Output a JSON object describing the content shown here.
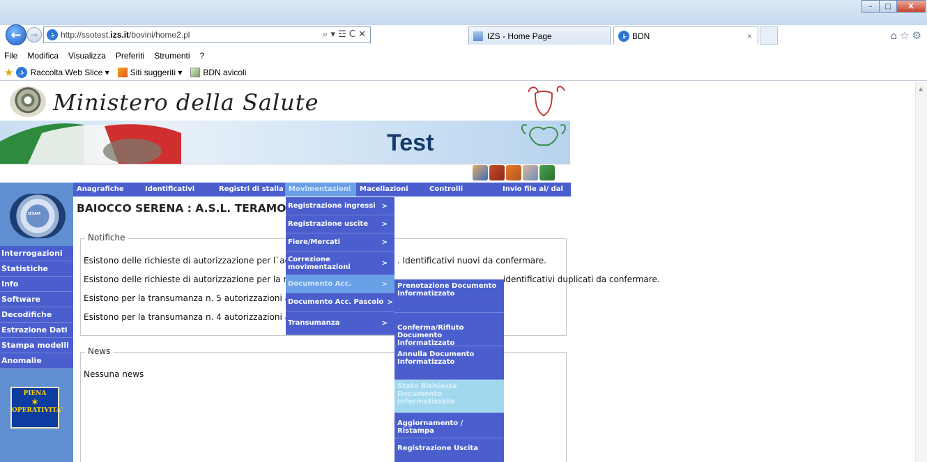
{
  "browser": {
    "url_prefix": "http://ssotest.",
    "url_domain": "izs.it",
    "url_suffix": "/bovini/home2.pl",
    "addr_tools": "⌕ ▾ ☲ C ✕",
    "tabs": [
      {
        "title": "IZS - Home Page"
      },
      {
        "title": "BDN",
        "close": "×"
      }
    ],
    "menu": [
      "File",
      "Modifica",
      "Visualizza",
      "Preferiti",
      "Strumenti",
      "?"
    ],
    "favorites": [
      {
        "label": "Raccolta Web Slice ▾"
      },
      {
        "label": "Siti suggeriti ▾"
      },
      {
        "label": "BDN avicoli"
      }
    ],
    "window_buttons": {
      "min": "–",
      "max": "□",
      "close": "X"
    },
    "right_icons": "⌂☆⚙",
    "back_glyph": "←",
    "fwd_glyph": "→"
  },
  "header": {
    "ministry": "Ministero della Salute",
    "test_label": "Test"
  },
  "nav": {
    "top": [
      "Anagrafiche",
      "Identificativi",
      "Registri di stalla",
      "Movimentazioni",
      "Macellazioni",
      "Controlli",
      "Invio file al/ dal"
    ],
    "active_index": 3,
    "left": [
      "Interrogazioni",
      "Statistiche",
      "Info",
      "Software",
      "Decodifiche",
      "Estrazione Dati",
      "Stampa modelli",
      "Anomalie"
    ]
  },
  "izsam_text": "IZSAM",
  "piena": {
    "line1": "PIENA",
    "stars": "✶",
    "line2": "OPERATIVITA'"
  },
  "user_title": "BAIOCCO SERENA : A.S.L. TERAMO",
  "notifiche": {
    "legend": "Notifiche",
    "rows": [
      {
        "left": "Esistono delle richieste di autorizzazione per l`ac",
        "right": ". Identificativi nuovi da confermare."
      },
      {
        "left": "Esistono delle richieste di autorizzazione per la ri",
        "right": "identificativi duplicati da confermare."
      },
      {
        "left": "Esistono per la transumanza n. 5 autorizzazioni a",
        "right": ""
      },
      {
        "left": "Esistono per la transumanza n. 4 autorizzazioni a",
        "right": ""
      }
    ]
  },
  "news": {
    "legend": "News",
    "text": "Nessuna news"
  },
  "dropdown_movimentazioni": [
    {
      "label": "Registrazione ingressi",
      "arrow": ">"
    },
    {
      "label": "Registrazione uscite",
      "arrow": ">"
    },
    {
      "label": "Fiere/Mercati",
      "arrow": ">"
    },
    {
      "label": "Correzione movimentazioni",
      "arrow": ">"
    },
    {
      "label": "Documento Acc.",
      "arrow": ">"
    },
    {
      "label": "Documento Acc. Pascolo",
      "arrow": ">"
    },
    {
      "label": "Transumanza",
      "arrow": ">"
    }
  ],
  "dropdown_documento": [
    {
      "label": "Prenotazione Documento Informatizzato"
    },
    {
      "label": "Conferma/Rifiuto Documento Informatizzato"
    },
    {
      "label": "Annulla Documento Informatizzato"
    },
    {
      "label": "Stato Richiesta Documento Informatizzato"
    },
    {
      "label": "Aggiornamento / Ristampa"
    },
    {
      "label": "Registrazione Uscita"
    }
  ],
  "colors": {
    "nav_bg": "#4a5fcd",
    "nav_active": "#6aa0e6",
    "left_bg": "#5f8fd0",
    "hover": "#a2d8ee"
  }
}
